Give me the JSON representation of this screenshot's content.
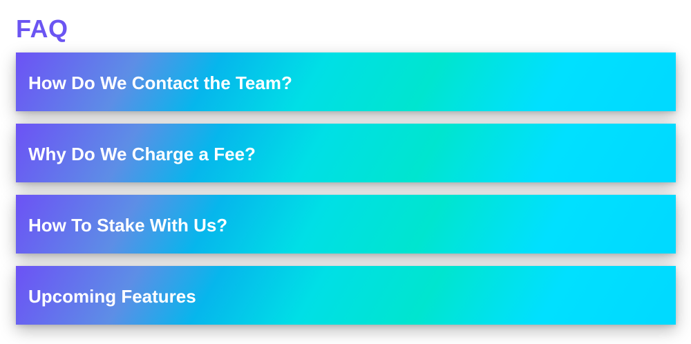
{
  "page": {
    "title": "FAQ",
    "title_color": "#6b55f2"
  },
  "faq": {
    "items": [
      {
        "question": "How Do We Contact the Team?"
      },
      {
        "question": "Why Do We Charge a Fee?"
      },
      {
        "question": "How To Stake With Us?"
      },
      {
        "question": "Upcoming Features"
      }
    ],
    "gradient_colors": [
      "#6c52f5",
      "#06b6ec",
      "#00e5cf",
      "#00d9ff"
    ],
    "text_color": "#ffffff"
  }
}
